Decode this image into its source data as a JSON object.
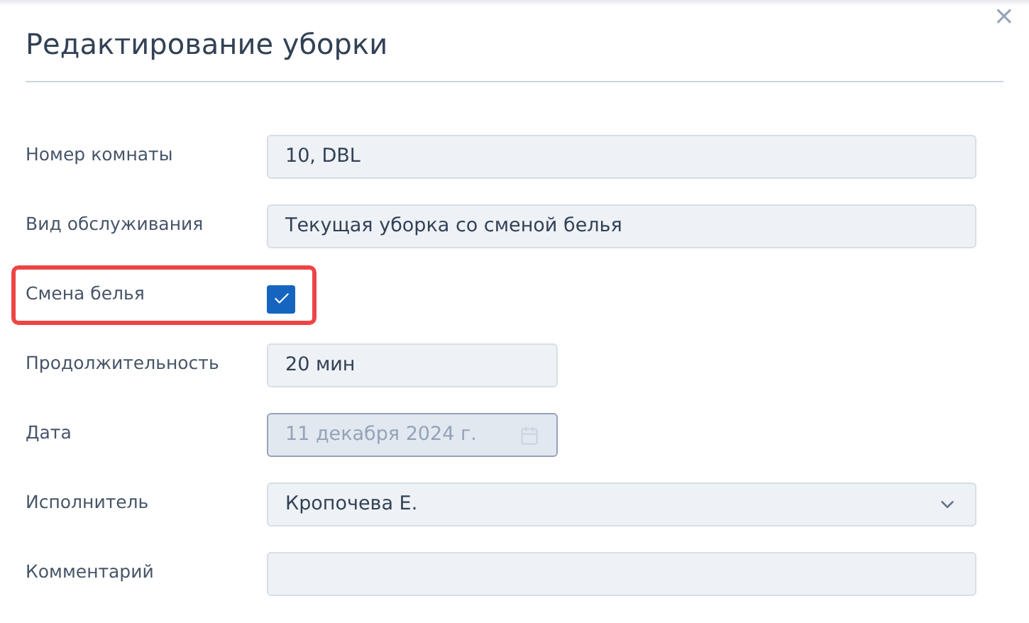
{
  "dialog": {
    "title": "Редактирование уборки",
    "close": "×"
  },
  "fields": [
    {
      "kind": "text",
      "label": "Номер комнаты",
      "value": "10, DBL",
      "wide": true,
      "disabled": false,
      "highlighted": false
    },
    {
      "kind": "text",
      "label": "Вид обслуживания",
      "value": "Текущая уборка со сменой белья",
      "wide": true,
      "disabled": false,
      "highlighted": false
    },
    {
      "kind": "checkbox",
      "label": "Смена белья",
      "checked": true,
      "highlighted": true
    },
    {
      "kind": "text",
      "label": "Продолжительность",
      "value": "20 мин",
      "wide": false,
      "disabled": false,
      "highlighted": false
    },
    {
      "kind": "date",
      "label": "Дата",
      "value": "11 декабря 2024 г.",
      "wide": false,
      "disabled": true,
      "highlighted": false
    },
    {
      "kind": "select",
      "label": "Исполнитель",
      "value": "Кропочева Е.",
      "wide": true,
      "disabled": false,
      "highlighted": false
    },
    {
      "kind": "text",
      "label": "Комментарий",
      "wide": true,
      "disabled": false,
      "highlighted": false
    }
  ]
}
